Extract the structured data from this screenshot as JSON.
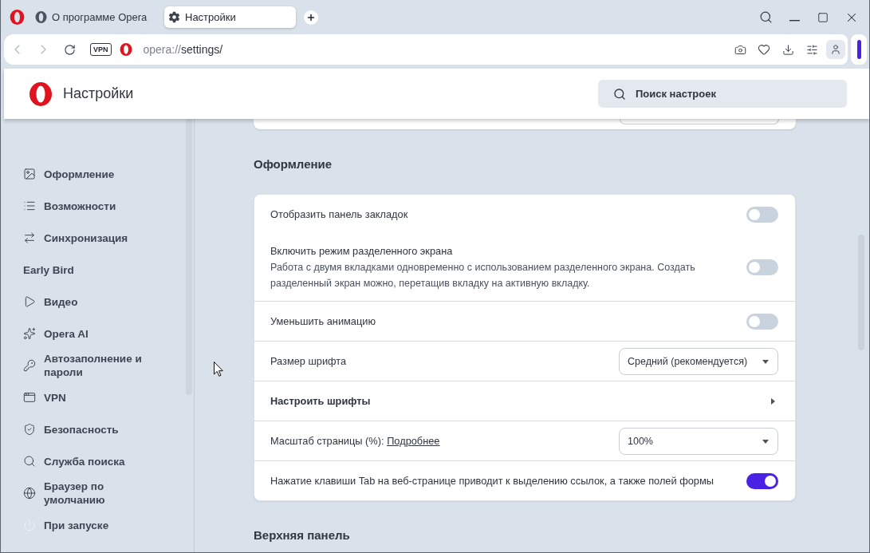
{
  "tabs": [
    {
      "label": "О программе Opera",
      "selected": false
    },
    {
      "label": "Настройки",
      "selected": true
    }
  ],
  "address_bar": {
    "back": {
      "disabled": true
    },
    "forward": {
      "disabled": true
    },
    "vpn_badge": "VPN",
    "url_scheme": "opera://",
    "url_path": "settings/"
  },
  "header": {
    "title": "Настройки",
    "search": {
      "placeholder": "Поиск настроек"
    }
  },
  "sidebar": {
    "items": [
      {
        "kind": "icon",
        "label": "Оформление",
        "selected": false
      },
      {
        "kind": "icon",
        "label": "Возможности",
        "selected": false
      },
      {
        "kind": "icon",
        "label": "Синхронизация",
        "selected": false
      },
      {
        "kind": "plain",
        "label": "Early Bird",
        "selected": false
      },
      {
        "kind": "icon",
        "label": "Видео",
        "selected": false
      },
      {
        "kind": "icon",
        "label": "Opera AI",
        "selected": false
      },
      {
        "kind": "icon",
        "label": "Автозаполнение и пароли",
        "selected": false
      },
      {
        "kind": "icon",
        "label": "VPN",
        "selected": false
      },
      {
        "kind": "icon",
        "label": "Безопасность",
        "selected": false
      },
      {
        "kind": "icon",
        "label": "Служба поиска",
        "selected": false
      },
      {
        "kind": "icon",
        "label": "Браузер по умолчанию",
        "selected": false
      },
      {
        "kind": "icon",
        "label": "При запуске",
        "selected": false
      }
    ]
  },
  "sections": [
    {
      "title": "Оформление",
      "groups": [
        {
          "rows": [
            {
              "kind": "toggle",
              "label": "Отобразить панель закладок",
              "on": false
            },
            {
              "kind": "toggle",
              "label": "Включить режим разделенного экрана",
              "description": "Работа с двумя вкладками одновременно с использованием разделенного экрана. Создать разделенный экран можно, перетащив вкладку на активную вкладку.",
              "on": false
            }
          ]
        },
        {
          "rows": [
            {
              "kind": "toggle",
              "label": "Уменьшить анимацию",
              "on": false
            }
          ]
        },
        {
          "rows": [
            {
              "kind": "select",
              "label": "Размер шрифта",
              "value": "Средний (рекомендуется)"
            }
          ]
        },
        {
          "rows": [
            {
              "kind": "submenu",
              "label": "Настроить шрифты"
            }
          ]
        },
        {
          "rows": [
            {
              "kind": "select",
              "label": "Масштаб страницы (%):",
              "link": "Подробнее",
              "value": "100%"
            }
          ]
        },
        {
          "rows": [
            {
              "kind": "toggle",
              "label": "Нажатие клавиши Tab на веб-странице приводит к выделению ссылок, а также полей формы",
              "on": true
            }
          ]
        }
      ]
    },
    {
      "title": "Верхняя панель"
    }
  ]
}
